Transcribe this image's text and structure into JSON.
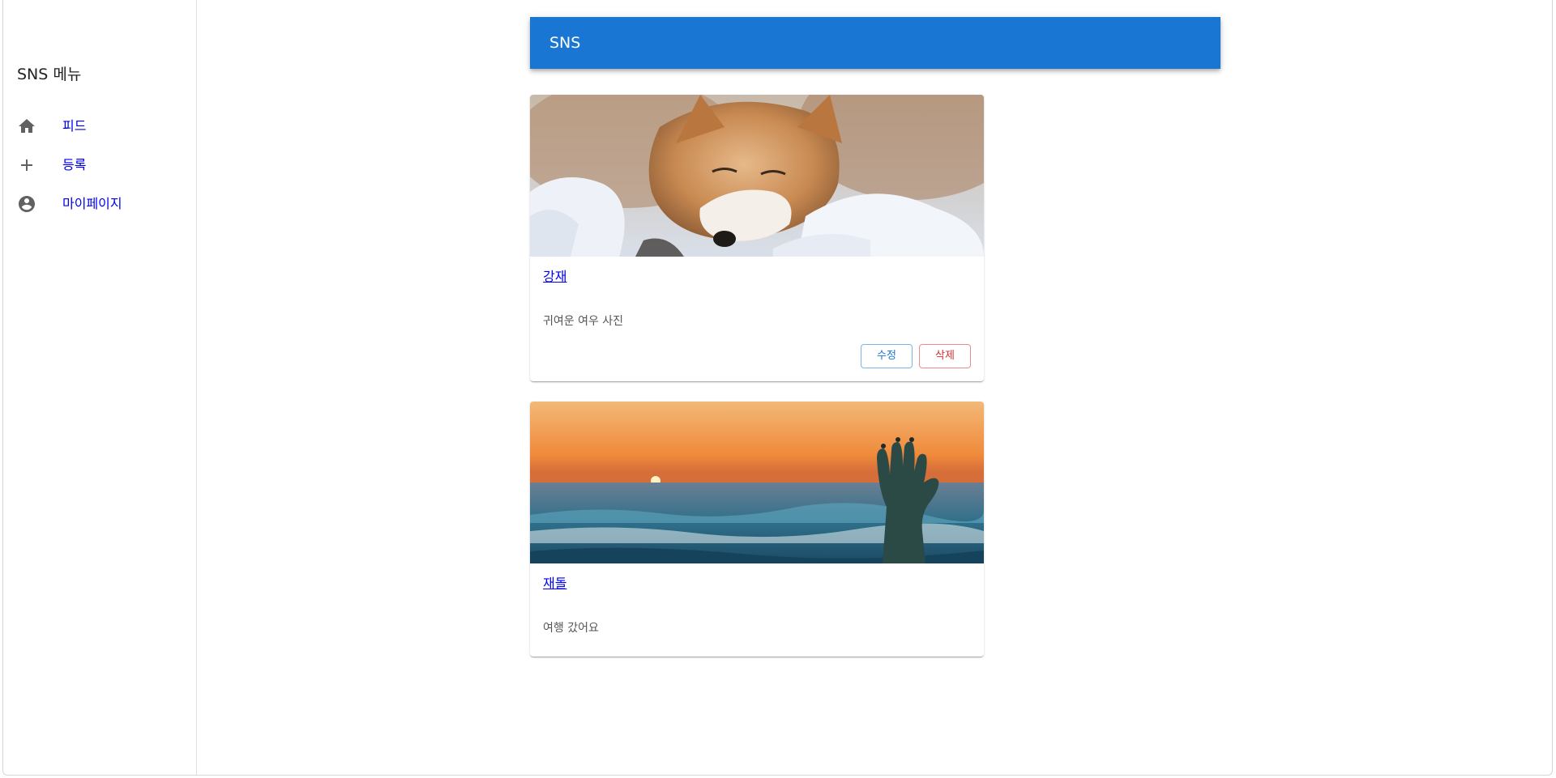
{
  "sidebar": {
    "title": "SNS 메뉴",
    "items": [
      {
        "label": "피드",
        "icon": "home-icon"
      },
      {
        "label": "등록",
        "icon": "plus-icon"
      },
      {
        "label": "마이페이지",
        "icon": "account-circle-icon"
      }
    ]
  },
  "appbar": {
    "title": "SNS",
    "color": "#1976d2"
  },
  "posts": [
    {
      "author": "강재",
      "text": "귀여운 여우 사진",
      "image": "fox-in-snow-photo",
      "actions": {
        "edit_label": "수정",
        "delete_label": "삭제"
      }
    },
    {
      "author": "재돌",
      "text": "여행 갔어요",
      "image": "sunset-sea-hand-statue-photo"
    }
  ],
  "colors": {
    "link": "#0000ee",
    "edit": "#1976d2",
    "delete": "#d32f2f"
  }
}
